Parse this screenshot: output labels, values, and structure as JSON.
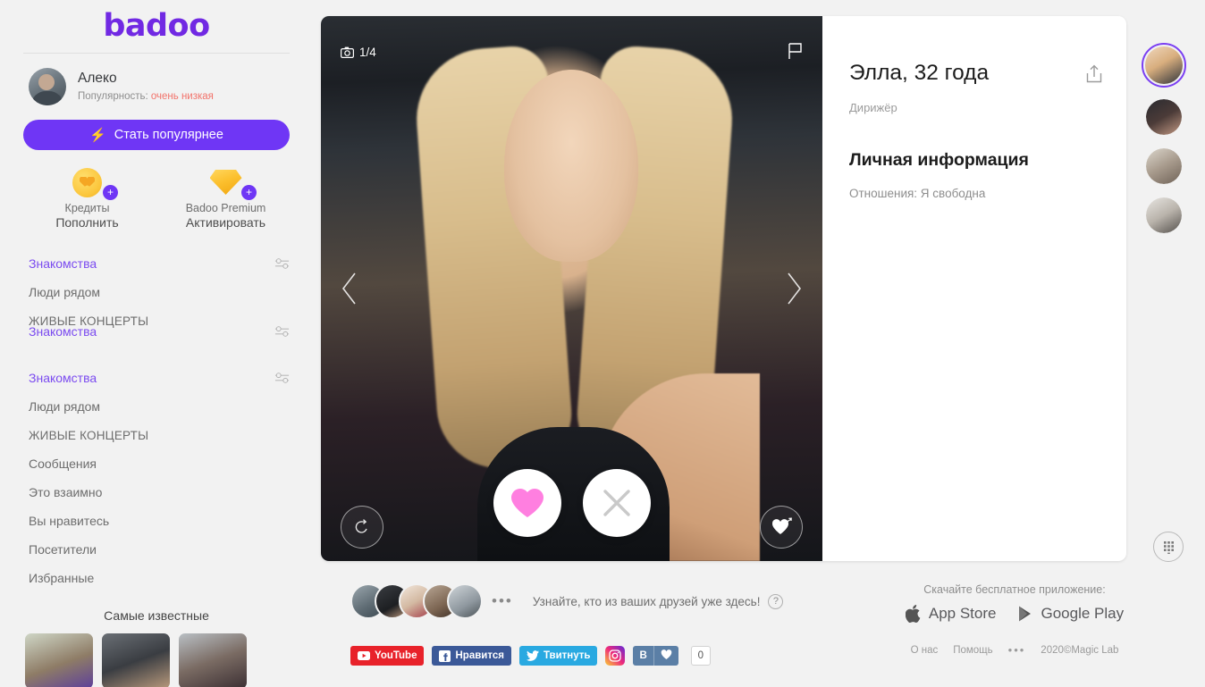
{
  "brand": {
    "name": "badoo"
  },
  "me": {
    "name": "Алеко",
    "popularity_label": "Популярность:",
    "popularity_value": "очень низкая",
    "cta_label": "Стать популярнее"
  },
  "perks": [
    {
      "title": "Кредиты",
      "action": "Пополнить",
      "icon": "coin-heart-icon",
      "badge": "+"
    },
    {
      "title": "Badoo Premium",
      "action": "Активировать",
      "icon": "gem-icon",
      "badge": "+"
    }
  ],
  "nav": {
    "group_a": [
      {
        "label": "Знакомства",
        "active": true,
        "has_filter": true
      },
      {
        "label": "Люди рядом",
        "active": false,
        "has_filter": false
      },
      {
        "label": "ЖИВЫЕ КОНЦЕРТЫ",
        "active": false,
        "has_filter": false
      }
    ],
    "ghost": {
      "label": "Знакомства",
      "active": true,
      "has_filter": true
    },
    "group_b": [
      {
        "label": "Знакомства",
        "active": true,
        "has_filter": true
      },
      {
        "label": "Люди рядом",
        "active": false,
        "has_filter": false
      },
      {
        "label": "ЖИВЫЕ КОНЦЕРТЫ",
        "active": false,
        "has_filter": false
      },
      {
        "label": "Сообщения",
        "active": false,
        "has_filter": false
      },
      {
        "label": "Это взаимно",
        "active": false,
        "has_filter": false
      },
      {
        "label": "Вы нравитесь",
        "active": false,
        "has_filter": false
      },
      {
        "label": "Посетители",
        "active": false,
        "has_filter": false
      },
      {
        "label": "Избранные",
        "active": false,
        "has_filter": false
      }
    ]
  },
  "famous": {
    "title": "Самые известные",
    "count": 3
  },
  "photo": {
    "counter": "1/4",
    "camera_icon": "camera-icon",
    "flag_icon": "flag-icon",
    "prev_icon": "chevron-left-icon",
    "next_icon": "chevron-right-icon",
    "undo_icon": "undo-icon",
    "like_icon": "heart-icon",
    "skip_icon": "close-icon",
    "crush_icon": "heart-arrow-icon"
  },
  "profile": {
    "name_age": "Элла, 32 года",
    "job": "Дирижёр",
    "section_title": "Личная информация",
    "relationship": "Отношения: Я свободна",
    "share_icon": "share-icon"
  },
  "rail": {
    "count": 4,
    "grid_icon": "grid-icon"
  },
  "friends": {
    "text": "Узнайте, кто из ваших друзей уже здесь!",
    "dots": "•••",
    "help": "?",
    "avatar_count": 5
  },
  "social": [
    {
      "name": "YouTube",
      "label": "YouTube",
      "icon": "youtube-icon"
    },
    {
      "name": "Facebook",
      "label": "Нравится",
      "icon": "facebook-icon"
    },
    {
      "name": "Twitter",
      "label": "Твитнуть",
      "icon": "twitter-icon"
    },
    {
      "name": "Instagram",
      "label": "",
      "icon": "instagram-icon"
    },
    {
      "name": "VK",
      "label": "В",
      "icon": "vk-icon",
      "count": "0"
    }
  ],
  "appbox": {
    "title": "Скачайте бесплатное приложение:",
    "stores": [
      {
        "label": "App Store",
        "icon": "apple-icon"
      },
      {
        "label": "Google Play",
        "icon": "play-icon"
      }
    ],
    "links": [
      "О нас",
      "Помощь"
    ],
    "more": "•••",
    "copyright": "2020©Magic Lab"
  },
  "colors": {
    "brand_purple": "#7129e3",
    "cta_purple": "#6f36f5",
    "active_link": "#7b4bf0",
    "popularity_red": "#f2736b",
    "heart_pink": "#ff7fe0",
    "page_bg": "#f2f2f2"
  }
}
